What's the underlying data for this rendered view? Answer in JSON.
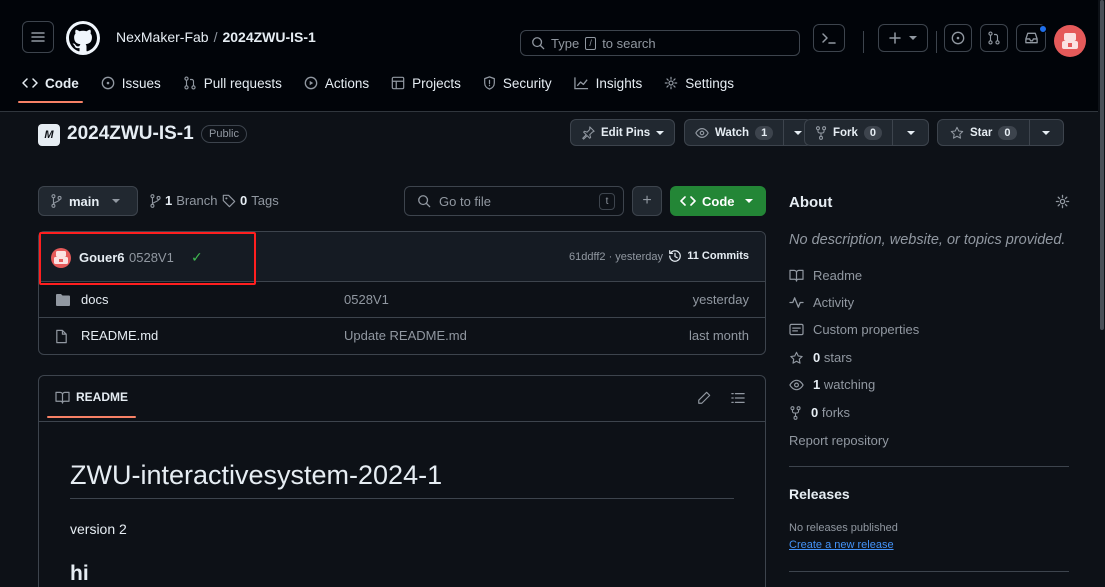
{
  "header": {
    "owner": "NexMaker-Fab",
    "separator": "/",
    "repo": "2024ZWU-IS-1",
    "search_pre": "Type",
    "search_key": "/",
    "search_post": "to search"
  },
  "tabs": [
    {
      "label": "Code",
      "icon": "code-icon"
    },
    {
      "label": "Issues",
      "icon": "issue-icon"
    },
    {
      "label": "Pull requests",
      "icon": "pull-request-icon"
    },
    {
      "label": "Actions",
      "icon": "play-icon"
    },
    {
      "label": "Projects",
      "icon": "table-icon"
    },
    {
      "label": "Security",
      "icon": "shield-icon"
    },
    {
      "label": "Insights",
      "icon": "graph-icon"
    },
    {
      "label": "Settings",
      "icon": "gear-icon"
    }
  ],
  "repo_title": {
    "logo_text": "M",
    "name": "2024ZWU-IS-1",
    "visibility": "Public",
    "edit_pins": "Edit Pins",
    "watch": "Watch",
    "watch_count": "1",
    "fork": "Fork",
    "fork_count": "0",
    "star": "Star",
    "star_count": "0"
  },
  "nav": {
    "branch": "main",
    "branches_count": "1",
    "branches_label": "Branch",
    "tags_count": "0",
    "tags_label": "Tags",
    "goto_placeholder": "Go to file",
    "goto_key": "t",
    "plus": "+",
    "code_button": "Code"
  },
  "latest_commit": {
    "user": "Gouer6",
    "message": "0528V1",
    "check": "✓",
    "meta": "61ddff2 · yesterday",
    "commits": "11 Commits"
  },
  "files": [
    {
      "type": "folder",
      "name": "docs",
      "message": "0528V1",
      "date": "yesterday"
    },
    {
      "type": "file",
      "name": "README.md",
      "message": "Update README.md",
      "date": "last month"
    }
  ],
  "readme": {
    "tab": "README",
    "h1": "ZWU-interactivesystem-2024-1",
    "p": "version 2",
    "h2": "hi"
  },
  "about": {
    "title": "About",
    "description": "No description, website, or topics provided.",
    "readme": "Readme",
    "activity": "Activity",
    "custom_props": "Custom properties",
    "stars_count": "0",
    "stars_label": "stars",
    "watching_count": "1",
    "watching_label": "watching",
    "forks_count": "0",
    "forks_label": "forks",
    "report": "Report repository"
  },
  "releases": {
    "title": "Releases",
    "none": "No releases published",
    "create": "Create a new release"
  },
  "colors": {
    "accent_green": "#238636",
    "tab_underline": "#f78166",
    "highlight_box": "#ff1f1f",
    "link": "#4493f8"
  }
}
